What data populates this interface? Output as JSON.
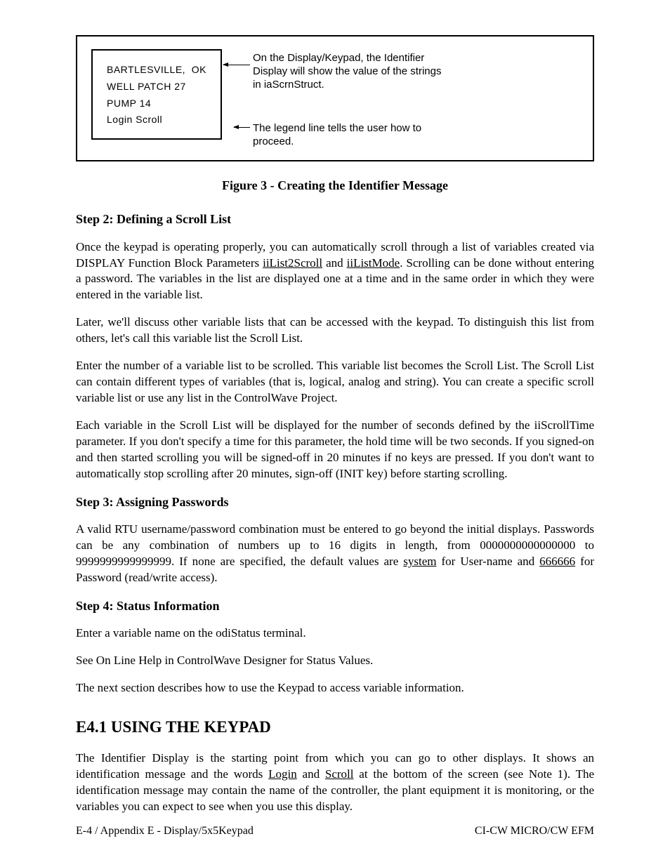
{
  "figure": {
    "display": {
      "line1_left": "BARTLESVILLE,",
      "line1_right": "OK",
      "line2": "WELL  PATCH  27",
      "line3": "PUMP  14",
      "line4": "Login  Scroll"
    },
    "callout1": "On the Display/Keypad, the Identifier Display will show the value of the strings in iaScrnStruct.",
    "callout2": "The legend line tells the user how to proceed.",
    "caption": "Figure 3 - Creating the Identifier Message"
  },
  "step2": {
    "heading": "Step 2:  Defining a Scroll List",
    "p1a": "Once the keypad is operating properly, you can automatically scroll through a list of variables created via DISPLAY Function Block Parameters ",
    "p1u1": "iiList2Scroll",
    "p1b": " and ",
    "p1u2": "iiListMode",
    "p1c": ". Scrolling can be done without entering a password. The variables in the list are displayed one at a time and in the same order in which they were entered in the variable list.",
    "p2": "Later, we'll discuss other variable lists that can be accessed with the keypad. To distinguish this list from others, let's call this variable list the Scroll List.",
    "p3": "Enter the number of a variable list to be scrolled. This variable list becomes the Scroll List. The Scroll List can contain different types of variables (that is, logical, analog and string). You can create a specific scroll variable list or use any list in the ControlWave Project.",
    "p4": "Each variable in the Scroll List will be displayed for the number of seconds defined by the iiScrollTime parameter. If you don't specify a time for this parameter, the hold time will be two seconds. If you signed-on and then started scrolling you will be signed-off in 20 minutes if no keys are pressed. If you don't want to automatically stop scrolling after 20 minutes, sign-off (INIT key) before starting scrolling."
  },
  "step3": {
    "heading": "Step 3:  Assigning Passwords",
    "p1a": "A valid RTU username/password combination must be entered to go beyond the initial displays. Passwords can be any combination of numbers up to 16 digits in length, from 0000000000000000 to 9999999999999999. If none are specified, the default values are ",
    "p1u1": "system",
    "p1b": " for User-name and ",
    "p1u2": "666666",
    "p1c": " for Password (read/write access)."
  },
  "step4": {
    "heading": "Step 4: Status Information",
    "p1": "Enter a variable name on the odiStatus terminal.",
    "p2": "See On Line Help in ControlWave Designer for Status Values.",
    "p3": "The next section describes how to use the Keypad to access variable information."
  },
  "section": {
    "heading": "E4.1  USING THE KEYPAD",
    "p1a": "The Identifier Display is the starting point from which you can go to other displays. It shows an identification message and the words ",
    "p1u1": "Login",
    "p1b": " and ",
    "p1u2": "Scroll",
    "p1c": " at the bottom of the screen (see Note 1). The identification message may contain the name of the controller, the plant equipment it is monitoring, or the variables you can expect to see when you use this display."
  },
  "footer": {
    "left": "E-4  /  Appendix E - Display/5x5Keypad",
    "right": "CI-CW MICRO/CW EFM"
  }
}
